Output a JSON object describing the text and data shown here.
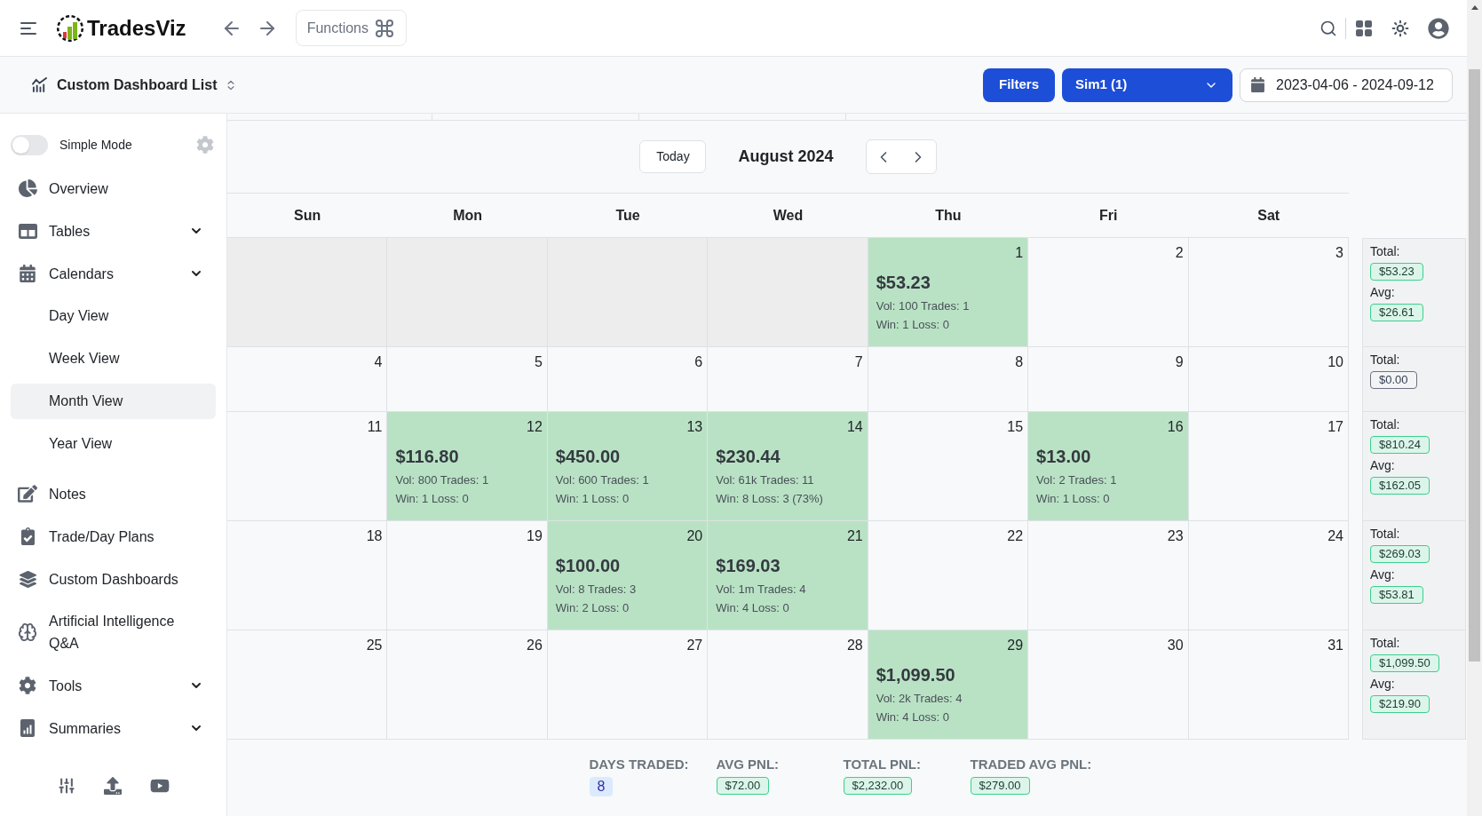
{
  "topbar": {
    "brand": "TradesViz",
    "functions": {
      "label": "Functions"
    }
  },
  "toolbar": {
    "title": "Custom Dashboard List",
    "filters": "Filters",
    "account": {
      "value": "Sim1 (1)"
    },
    "date_range": {
      "value": "2023-04-06 - 2024-09-12"
    }
  },
  "sidebar": {
    "simple_mode": {
      "label": "Simple Mode",
      "on": false
    },
    "items": [
      {
        "label": "Overview",
        "kind": "link",
        "selected": false
      },
      {
        "label": "Tables",
        "kind": "group",
        "selected": false
      },
      {
        "label": "Calendars",
        "kind": "group",
        "selected": false,
        "children": [
          {
            "label": "Day View",
            "selected": false
          },
          {
            "label": "Week View",
            "selected": false
          },
          {
            "label": "Month View",
            "selected": true
          },
          {
            "label": "Year View",
            "selected": false
          }
        ]
      },
      {
        "label": "Notes",
        "kind": "link",
        "selected": false
      },
      {
        "label": "Trade/Day Plans",
        "kind": "link",
        "selected": false
      },
      {
        "label": "Custom Dashboards",
        "kind": "link",
        "selected": false
      },
      {
        "label": "Artificial Intelligence Q&A",
        "kind": "link",
        "selected": false
      },
      {
        "label": "Tools",
        "kind": "group",
        "selected": false
      },
      {
        "label": "Summaries",
        "kind": "group",
        "selected": false
      }
    ]
  },
  "calendar": {
    "today_button": "Today",
    "month": "August 2024",
    "weekdays": [
      "Sun",
      "Mon",
      "Tue",
      "Wed",
      "Thu",
      "Fri",
      "Sat"
    ],
    "weeks": [
      {
        "days": [
          {
            "kind": "outside"
          },
          {
            "kind": "outside"
          },
          {
            "kind": "outside"
          },
          {
            "kind": "outside"
          },
          {
            "kind": "traded",
            "date": "1",
            "pnl": "$53.23",
            "stats": "Vol: 100 Trades: 1",
            "result": "Win: 1 Loss: 0"
          },
          {
            "kind": "plain",
            "date": "2"
          },
          {
            "kind": "plain",
            "date": "3"
          }
        ],
        "summary": [
          {
            "label": "Total:",
            "value": "$53.23",
            "kind": "positive"
          },
          {
            "label": "Avg:",
            "value": "$26.61",
            "kind": "positive"
          }
        ]
      },
      {
        "days": [
          {
            "kind": "plain",
            "date": "4"
          },
          {
            "kind": "plain",
            "date": "5"
          },
          {
            "kind": "plain",
            "date": "6"
          },
          {
            "kind": "plain",
            "date": "7"
          },
          {
            "kind": "plain",
            "date": "8"
          },
          {
            "kind": "plain",
            "date": "9"
          },
          {
            "kind": "plain",
            "date": "10"
          }
        ],
        "summary": [
          {
            "label": "Total:",
            "value": "$0.00",
            "kind": "neutral"
          }
        ]
      },
      {
        "days": [
          {
            "kind": "plain",
            "date": "11"
          },
          {
            "kind": "traded",
            "date": "12",
            "pnl": "$116.80",
            "stats": "Vol: 800 Trades: 1",
            "result": "Win: 1 Loss: 0"
          },
          {
            "kind": "traded",
            "date": "13",
            "pnl": "$450.00",
            "stats": "Vol: 600 Trades: 1",
            "result": "Win: 1 Loss: 0"
          },
          {
            "kind": "traded",
            "date": "14",
            "pnl": "$230.44",
            "stats": "Vol: 61k Trades: 11",
            "result": "Win: 8 Loss: 3 (73%)"
          },
          {
            "kind": "plain",
            "date": "15"
          },
          {
            "kind": "traded",
            "date": "16",
            "pnl": "$13.00",
            "stats": "Vol: 2 Trades: 1",
            "result": "Win: 1 Loss: 0"
          },
          {
            "kind": "plain",
            "date": "17"
          }
        ],
        "summary": [
          {
            "label": "Total:",
            "value": "$810.24",
            "kind": "positive"
          },
          {
            "label": "Avg:",
            "value": "$162.05",
            "kind": "positive"
          }
        ]
      },
      {
        "days": [
          {
            "kind": "plain",
            "date": "18"
          },
          {
            "kind": "plain",
            "date": "19"
          },
          {
            "kind": "traded",
            "date": "20",
            "pnl": "$100.00",
            "stats": "Vol: 8 Trades: 3",
            "result": "Win: 2 Loss: 0"
          },
          {
            "kind": "traded",
            "date": "21",
            "pnl": "$169.03",
            "stats": "Vol: 1m Trades: 4",
            "result": "Win: 4 Loss: 0"
          },
          {
            "kind": "plain",
            "date": "22"
          },
          {
            "kind": "plain",
            "date": "23"
          },
          {
            "kind": "plain",
            "date": "24"
          }
        ],
        "summary": [
          {
            "label": "Total:",
            "value": "$269.03",
            "kind": "positive"
          },
          {
            "label": "Avg:",
            "value": "$53.81",
            "kind": "positive"
          }
        ]
      },
      {
        "days": [
          {
            "kind": "plain",
            "date": "25"
          },
          {
            "kind": "plain",
            "date": "26"
          },
          {
            "kind": "plain",
            "date": "27"
          },
          {
            "kind": "plain",
            "date": "28"
          },
          {
            "kind": "traded",
            "date": "29",
            "pnl": "$1,099.50",
            "stats": "Vol: 2k Trades: 4",
            "result": "Win: 4 Loss: 0"
          },
          {
            "kind": "plain",
            "date": "30"
          },
          {
            "kind": "plain",
            "date": "31"
          }
        ],
        "summary": [
          {
            "label": "Total:",
            "value": "$1,099.50",
            "kind": "positive"
          },
          {
            "label": "Avg:",
            "value": "$219.90",
            "kind": "positive"
          }
        ]
      }
    ]
  },
  "totals": [
    {
      "label": "DAYS TRADED:",
      "value": "8",
      "kind": "count"
    },
    {
      "label": "AVG PNL:",
      "value": "$72.00",
      "kind": "positive"
    },
    {
      "label": "TOTAL PNL:",
      "value": "$2,232.00",
      "kind": "positive"
    },
    {
      "label": "TRADED AVG PNL:",
      "value": "$279.00",
      "kind": "positive"
    }
  ]
}
